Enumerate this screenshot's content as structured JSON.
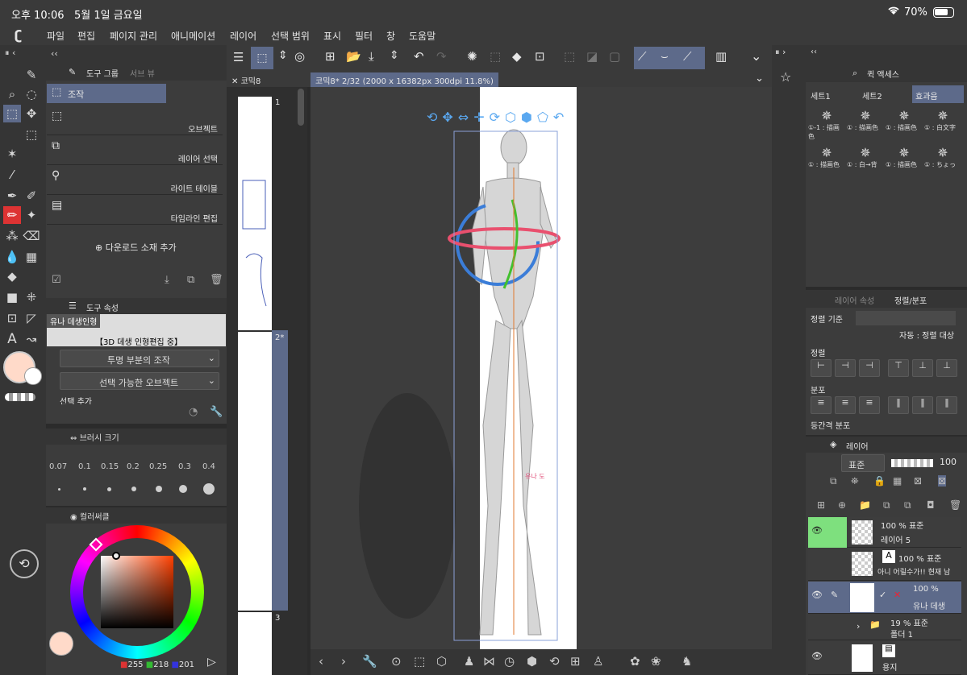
{
  "status": {
    "time": "오후 10:06",
    "date": "5월 1일 금요일",
    "battery": "70%",
    "wifi_icon": "wifi-icon",
    "battery_icon": "battery-icon"
  },
  "menu": [
    "파일",
    "편집",
    "페이지 관리",
    "애니메이션",
    "레이어",
    "선택 범위",
    "표시",
    "필터",
    "창",
    "도움말"
  ],
  "tool_group": {
    "title": "도구 그룹",
    "sub_tab": "서브 뷰",
    "group_label": "조작",
    "items": [
      "오브젝트",
      "레이어 선택",
      "라이트 테이블",
      "타임라인 편집"
    ],
    "add_material": "다운로드 소재 추가"
  },
  "tool_property": {
    "title": "도구 속성",
    "preview_label": "유나 데생인형",
    "editing": "【3D 데생 인형편집 중】",
    "opt1": "투명 부분의 조작",
    "opt2": "선택 가능한 오브젝트",
    "opt3": "선택 추가"
  },
  "brush_size": {
    "title": "브러시 크기",
    "sizes": [
      "0.07",
      "0.1",
      "0.15",
      "0.2",
      "0.25",
      "0.3",
      "0.4"
    ]
  },
  "color_wheel": {
    "title": "컬러써클",
    "r": "255",
    "g": "218",
    "b": "201",
    "main_color": "#ffdac9",
    "accent": "#5d6a8a"
  },
  "pages": {
    "tab": "코믹8",
    "numbers": [
      "1",
      "2*",
      "3"
    ]
  },
  "canvas": {
    "tab": "코믹8* 2/32 (2000 x 16382px 300dpi 11.8%)",
    "caption": "유나 도"
  },
  "quick_access": {
    "title": "퀵 액세스",
    "tabs": [
      "세트1",
      "세트2",
      "효과음"
    ],
    "items": [
      "①-1 : 描画色",
      "① : 描画色",
      "① : 描画色",
      "① : 白文字",
      "① : 描画色",
      "① : 白→背",
      "① : 描画色",
      "① : ちょっ"
    ]
  },
  "align": {
    "tabs": [
      "레이어 속성",
      "정렬/분포"
    ],
    "basis_label": "정렬 기준",
    "auto_label": "자동 : 정렬 대상",
    "align_label": "정렬",
    "distribute_label": "분포",
    "equal_label": "등간격 분포"
  },
  "layers": {
    "title": "레이어",
    "blend": "표준",
    "opacity": "100",
    "items": [
      {
        "pct": "100 % 표준",
        "name": "레이어 5"
      },
      {
        "pct": "100 % 표준",
        "name": "아니 어릴수가!! 현재 남"
      },
      {
        "pct": "100 %",
        "name": "유나 데생"
      },
      {
        "pct": "19 % 표준",
        "name": "폴더 1"
      },
      {
        "pct": "",
        "name": "용지"
      }
    ]
  }
}
